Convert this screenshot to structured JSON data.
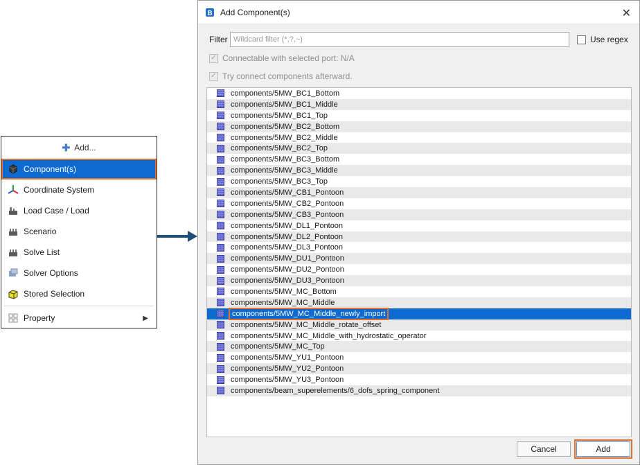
{
  "menu": {
    "header": "Add...",
    "items": [
      {
        "label": "Component(s)",
        "icon": "component-cube-icon",
        "selected": true
      },
      {
        "label": "Coordinate System",
        "icon": "coordinate-axes-icon"
      },
      {
        "label": "Load Case / Load",
        "icon": "load-case-icon"
      },
      {
        "label": "Scenario",
        "icon": "scenario-icon"
      },
      {
        "label": "Solve List",
        "icon": "solve-list-icon"
      },
      {
        "label": "Solver Options",
        "icon": "solver-options-icon"
      },
      {
        "label": "Stored Selection",
        "icon": "stored-selection-icon"
      }
    ],
    "property": {
      "label": "Property",
      "icon": "property-grid-icon"
    }
  },
  "dialog": {
    "title": "Add Component(s)",
    "filter_label": "Filter",
    "filter_placeholder": "Wildcard filter (*,?,~)",
    "use_regex": "Use regex",
    "opt_connectable": "Connectable with selected port: N/A",
    "opt_try_connect": "Try connect components afterward.",
    "components": [
      "components/5MW_BC1_Bottom",
      "components/5MW_BC1_Middle",
      "components/5MW_BC1_Top",
      "components/5MW_BC2_Bottom",
      "components/5MW_BC2_Middle",
      "components/5MW_BC2_Top",
      "components/5MW_BC3_Bottom",
      "components/5MW_BC3_Middle",
      "components/5MW_BC3_Top",
      "components/5MW_CB1_Pontoon",
      "components/5MW_CB2_Pontoon",
      "components/5MW_CB3_Pontoon",
      "components/5MW_DL1_Pontoon",
      "components/5MW_DL2_Pontoon",
      "components/5MW_DL3_Pontoon",
      "components/5MW_DU1_Pontoon",
      "components/5MW_DU2_Pontoon",
      "components/5MW_DU3_Pontoon",
      "components/5MW_MC_Bottom",
      "components/5MW_MC_Middle",
      "components/5MW_MC_Middle_newly_import",
      "components/5MW_MC_Middle_rotate_offset",
      "components/5MW_MC_Middle_with_hydrostatic_operator",
      "components/5MW_MC_Top",
      "components/5MW_YU1_Pontoon",
      "components/5MW_YU2_Pontoon",
      "components/5MW_YU3_Pontoon",
      "components/beam_superelements/6_dofs_spring_component"
    ],
    "selected_index": 20,
    "cancel_label": "Cancel",
    "add_label": "Add"
  },
  "colors": {
    "selection": "#0d6ad1",
    "highlight": "#e0722f",
    "arrow": "#1f4e79"
  }
}
